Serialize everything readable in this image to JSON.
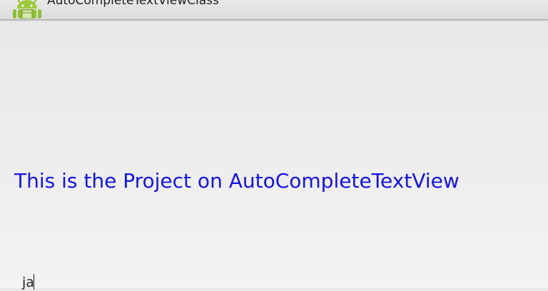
{
  "action_bar": {
    "title": "AutoCompleteTextViewClass",
    "icon": "android-robot-icon"
  },
  "main": {
    "headline": "This is the Project on AutoCompleteTextView",
    "headline_color": "#1414e6",
    "autocomplete_input": {
      "value": "ja"
    }
  }
}
